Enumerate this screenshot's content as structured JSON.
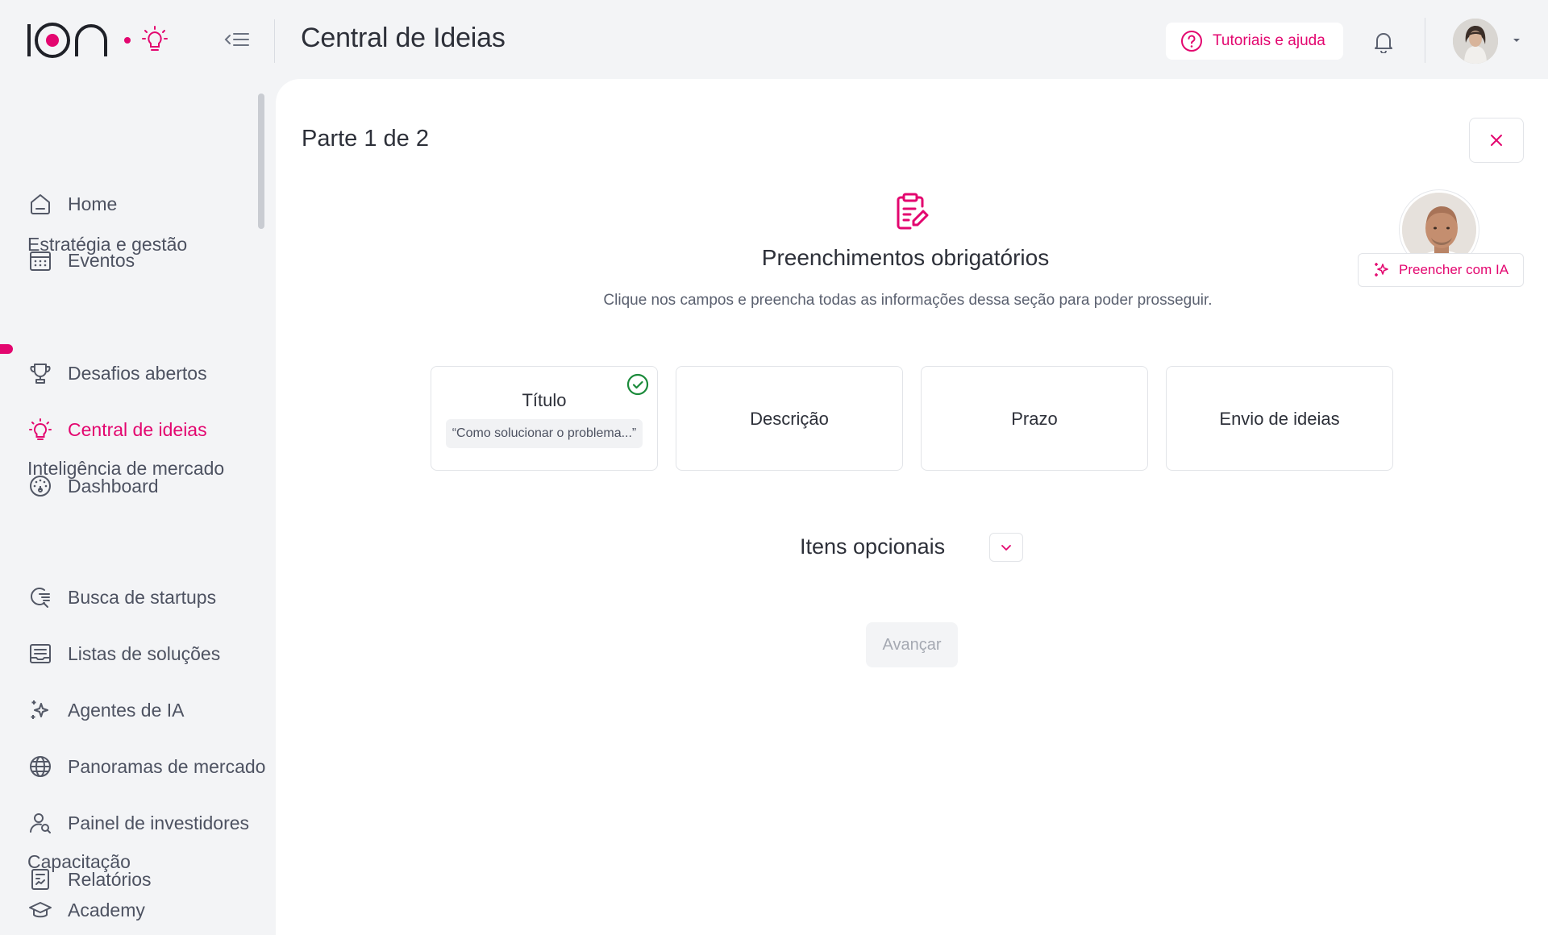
{
  "brand": {
    "accent": "#e3066f",
    "success": "#1a8a3a"
  },
  "header": {
    "title": "Central de Ideias",
    "help_label": "Tutoriais e ajuda"
  },
  "sidebar": {
    "items": [
      {
        "label": "Home",
        "icon": "home-icon"
      },
      {
        "label": "Eventos",
        "icon": "calendar-icon"
      }
    ],
    "sections": [
      {
        "title": "Estratégia e gestão",
        "items": [
          {
            "label": "Desafios abertos",
            "icon": "trophy-icon"
          },
          {
            "label": "Central de ideias",
            "icon": "lightbulb-icon",
            "active": true
          },
          {
            "label": "Dashboard",
            "icon": "dashboard-icon"
          }
        ]
      },
      {
        "title": "Inteligência de mercado",
        "items": [
          {
            "label": "Busca de startups",
            "icon": "search-list-icon"
          },
          {
            "label": "Listas de soluções",
            "icon": "list-icon"
          },
          {
            "label": "Agentes de IA",
            "icon": "sparkles-icon"
          },
          {
            "label": "Panoramas de mercado",
            "icon": "globe-icon"
          },
          {
            "label": "Painel de investidores",
            "icon": "investor-icon"
          },
          {
            "label": "Relatórios",
            "icon": "report-icon"
          }
        ]
      },
      {
        "title": "Capacitação",
        "items": [
          {
            "label": "Academy",
            "icon": "graduation-cap-icon"
          }
        ]
      }
    ]
  },
  "main": {
    "part_label": "Parte 1 de 2",
    "required": {
      "title": "Preenchimentos obrigatórios",
      "description": "Clique nos campos e preencha todas as informações dessa seção para poder prosseguir."
    },
    "ai_fill_label": "Preencher com IA",
    "cards": [
      {
        "label": "Título",
        "value": "“Como solucionar o problema...”",
        "completed": true
      },
      {
        "label": "Descrição"
      },
      {
        "label": "Prazo"
      },
      {
        "label": "Envio de ideias"
      }
    ],
    "optional_label": "Itens opcionais",
    "next_label": "Avançar"
  }
}
